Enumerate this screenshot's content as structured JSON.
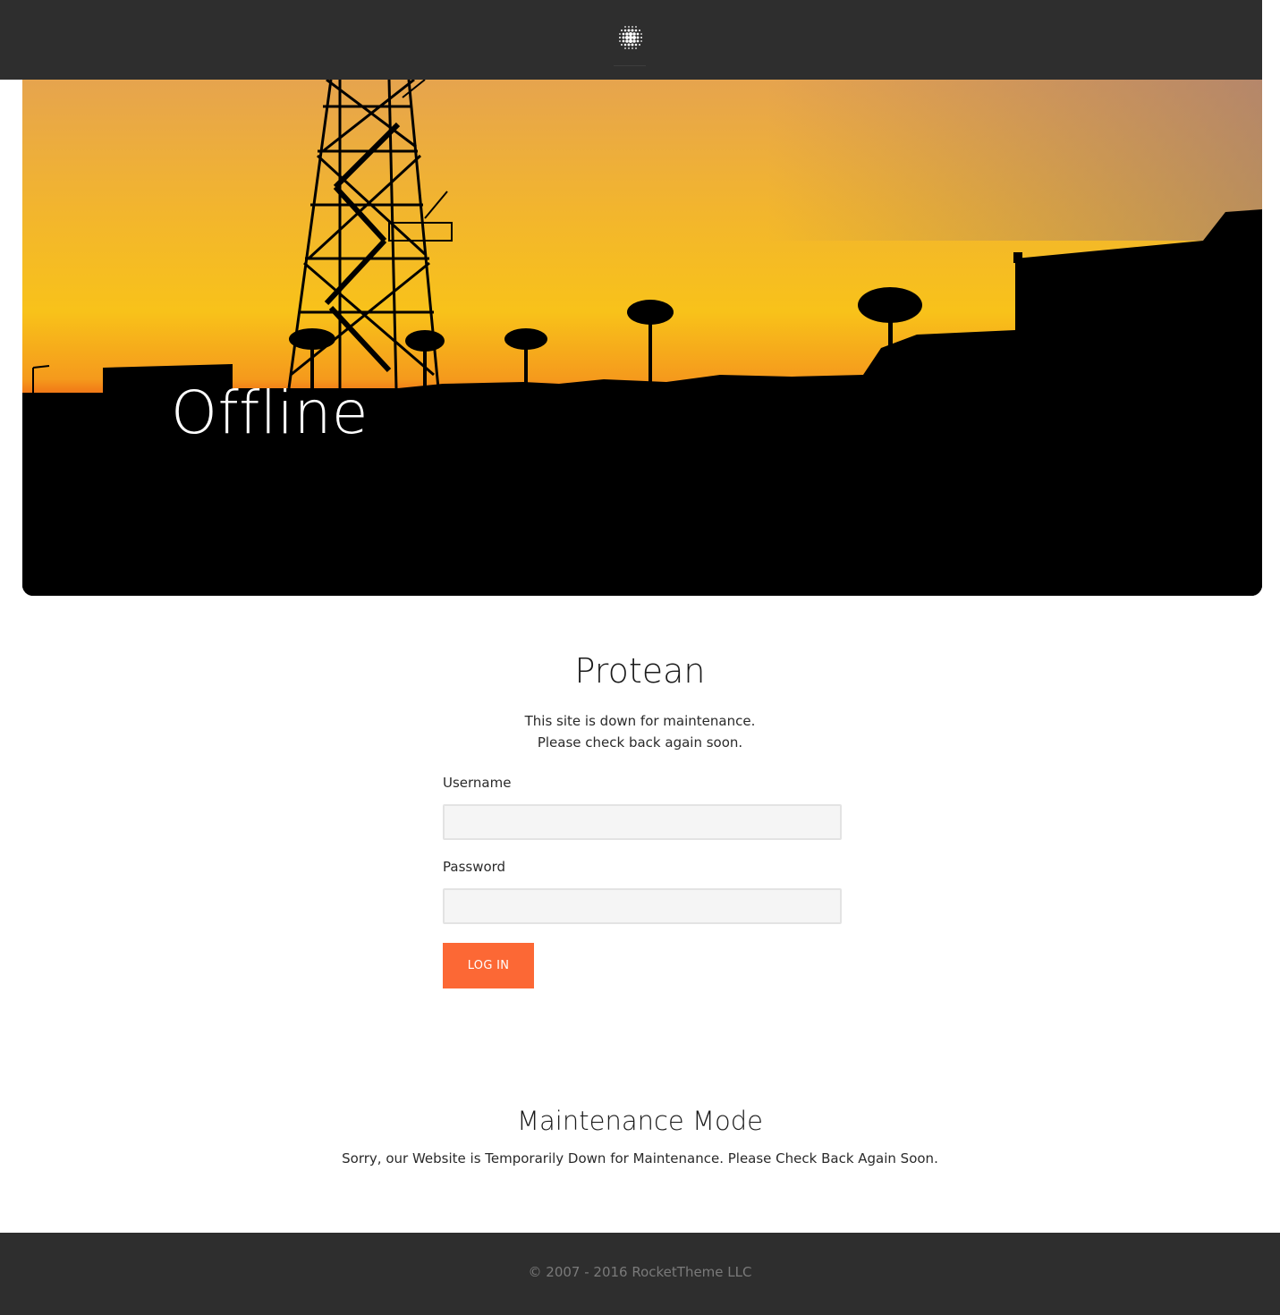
{
  "header": {
    "logo_icon": "rockettheme-dot-grid-logo-icon"
  },
  "hero": {
    "title": "Offline",
    "image": "sunset-launch-tower-silhouette"
  },
  "main": {
    "site_name": "Protean",
    "message_line1": "This site is down for maintenance.",
    "message_line2": "Please check back again soon."
  },
  "login": {
    "username_label": "Username",
    "username_value": "",
    "password_label": "Password",
    "password_value": "",
    "button_label": "LOG IN"
  },
  "maintenance": {
    "title": "Maintenance Mode",
    "text": "Sorry, our Website is Temporarily Down for Maintenance. Please Check Back Again Soon."
  },
  "footer": {
    "copyright": "© 2007 - 2016 RocketTheme LLC"
  },
  "colors": {
    "header_bg": "#2e2e2e",
    "footer_bg": "#2e2e2e",
    "accent": "#fc6835",
    "input_bg": "#f5f5f5"
  }
}
